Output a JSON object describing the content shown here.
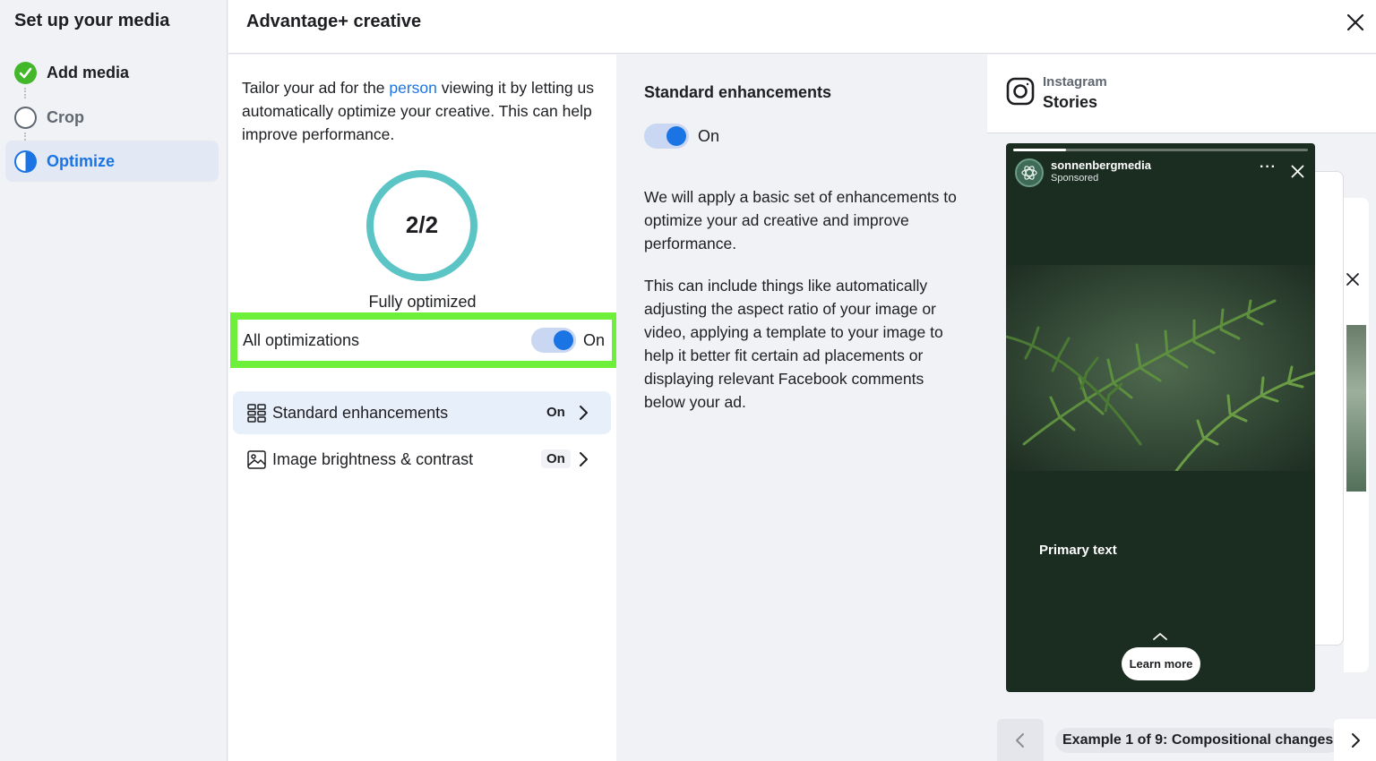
{
  "sidebar": {
    "title": "Set up your media",
    "steps": [
      {
        "label": "Add media",
        "state": "complete"
      },
      {
        "label": "Crop",
        "state": "pending"
      },
      {
        "label": "Optimize",
        "state": "active"
      }
    ]
  },
  "header": {
    "title": "Advantage+ creative"
  },
  "left_panel": {
    "intro_before": "Tailor your ad for the ",
    "intro_link": "person",
    "intro_after": " viewing it by letting us automatically optimize your creative. This can help improve performance.",
    "score": "2/2",
    "score_caption": "Fully optimized",
    "all_optimizations": {
      "label": "All optimizations",
      "state": "On"
    },
    "options": [
      {
        "label": "Standard enhancements",
        "state": "On",
        "icon": "grid-icon"
      },
      {
        "label": "Image brightness & contrast",
        "state": "On",
        "icon": "image-icon"
      }
    ]
  },
  "mid_panel": {
    "title": "Standard enhancements",
    "toggle_state": "On",
    "paragraph1": "We will apply a basic set of enhancements to optimize your ad creative and improve performance.",
    "paragraph2": "This can include things like automatically adjusting the aspect ratio of your image or video, applying a template to your image to help it better fit certain ad placements or displaying relevant Facebook comments below your ad."
  },
  "preview": {
    "platform": "Instagram",
    "placement": "Stories",
    "story": {
      "username": "sonnenbergmedia",
      "sponsored": "Sponsored",
      "more": "···",
      "primary_text": "Primary text",
      "cta": "Learn more"
    },
    "example_label": "Example 1 of 9: Compositional changes"
  },
  "colors": {
    "accent": "#1b74e4",
    "success": "#42b72a",
    "ring": "#5bc4c5",
    "highlight": "#6ef03b"
  }
}
